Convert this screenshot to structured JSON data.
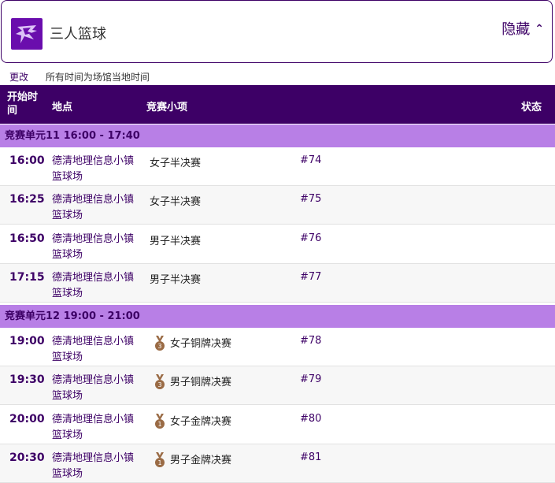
{
  "header": {
    "title": "三人篮球",
    "hide_label": "隐藏",
    "hide_chevron": "⌃"
  },
  "subbar": {
    "change_label": "更改",
    "timezone_note": "所有时间为场馆当地时间"
  },
  "table": {
    "columns": {
      "time": "开始时间",
      "venue": "地点",
      "event": "竞赛小项",
      "status": "状态"
    }
  },
  "sessions": [
    {
      "label": "竞赛单元11  16:00 - 17:40"
    },
    {
      "label": "竞赛单元12  19:00 - 21:00"
    }
  ],
  "rows": [
    {
      "time": "16:00",
      "venue": "德清地理信息小镇篮球场",
      "event": "女子半决赛",
      "number": "#74",
      "medal": ""
    },
    {
      "time": "16:25",
      "venue": "德清地理信息小镇篮球场",
      "event": "女子半决赛",
      "number": "#75",
      "medal": ""
    },
    {
      "time": "16:50",
      "venue": "德清地理信息小镇篮球场",
      "event": "男子半决赛",
      "number": "#76",
      "medal": ""
    },
    {
      "time": "17:15",
      "venue": "德清地理信息小镇篮球场",
      "event": "男子半决赛",
      "number": "#77",
      "medal": ""
    },
    {
      "time": "19:00",
      "venue": "德清地理信息小镇篮球场",
      "event": "女子铜牌决赛",
      "number": "#78",
      "medal": "bronze-medal-icon"
    },
    {
      "time": "19:30",
      "venue": "德清地理信息小镇篮球场",
      "event": "男子铜牌决赛",
      "number": "#79",
      "medal": "bronze-medal-icon"
    },
    {
      "time": "20:00",
      "venue": "德清地理信息小镇篮球场",
      "event": "女子金牌决赛",
      "number": "#80",
      "medal": "gold-medal-icon"
    },
    {
      "time": "20:30",
      "venue": "德清地理信息小镇篮球场",
      "event": "男子金牌决赛",
      "number": "#81",
      "medal": "gold-medal-icon"
    }
  ],
  "colors": {
    "primary": "#3d0066",
    "session_bg": "#b87fe6",
    "row_alt": "#f7f7f7",
    "medal": "#9a6b45"
  }
}
